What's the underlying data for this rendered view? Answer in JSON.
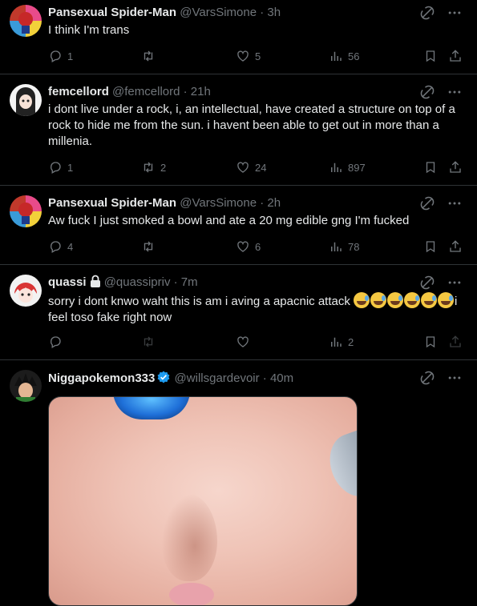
{
  "colors": {
    "background": "#000000",
    "text": "#e7e9ea",
    "muted": "#71767b",
    "border": "#2f3336",
    "verified": "#1d9bf0"
  },
  "tweets": [
    {
      "name": "Pansexual Spider-Man",
      "handle": "@VarsSimone · 3h",
      "text": "I think I'm trans",
      "replies": "1",
      "retweets": "",
      "likes": "5",
      "views": "56"
    },
    {
      "name": "femcellord",
      "handle": "@femcellord · 21h",
      "text": "i dont live under a rock, i, an intellectual, have created a structure on top of a rock to hide me from the sun. i havent been able to get out in more than a millenia.",
      "replies": "1",
      "retweets": "2",
      "likes": "24",
      "views": "897"
    },
    {
      "name": "Pansexual Spider-Man",
      "handle": "@VarsSimone · 2h",
      "text": "Aw fuck I just smoked a bowl and ate a 20 mg edible gng I'm fucked",
      "replies": "4",
      "retweets": "",
      "likes": "6",
      "views": "78"
    },
    {
      "name": "quassi",
      "handle": "@quassipriv · 7m",
      "text_a": "sorry i dont knwo waht this is am i aving a apacnic attack ",
      "text_b": "i feel toso fake right now",
      "replies": "",
      "retweets": "",
      "likes": "",
      "views": "2"
    },
    {
      "name": "Niggapokemon333",
      "handle": "@willsgardevoir · 40m"
    }
  ],
  "icons": {
    "grok": "grok-icon",
    "more": "more-icon",
    "reply": "reply-icon",
    "retweet": "retweet-icon",
    "like": "like-icon",
    "views": "views-icon",
    "bookmark": "bookmark-icon",
    "share": "share-icon"
  }
}
